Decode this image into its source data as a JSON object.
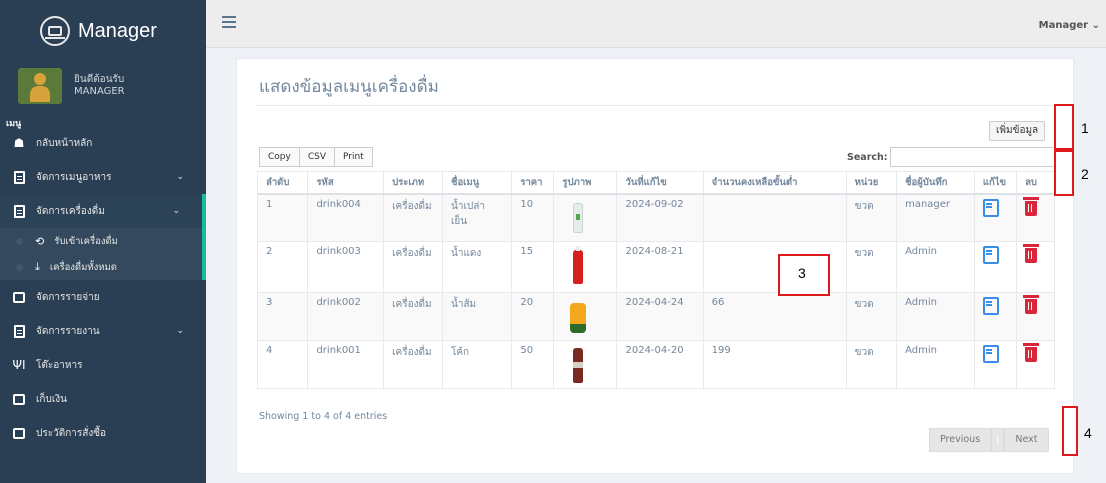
{
  "app": {
    "title": "Manager"
  },
  "profile": {
    "welcome": "ยินดีต้อนรับ",
    "name": "MANAGER"
  },
  "sidebar": {
    "heading": "เมนู",
    "items": [
      {
        "label": "กลับหน้าหลัก",
        "icon": "home-icon"
      },
      {
        "label": "จัดการเมนูอาหาร",
        "icon": "document-icon",
        "chevron": "⌄"
      },
      {
        "label": "จัดการเครื่องดื่ม",
        "icon": "document-icon",
        "chevron": "⌄"
      },
      {
        "label": "จัดการรายจ่าย",
        "icon": "money-icon"
      },
      {
        "label": "จัดการรายงาน",
        "icon": "document-icon",
        "chevron": "⌄"
      },
      {
        "label": "โต๊ะอาหาร",
        "icon": "utensils-icon"
      },
      {
        "label": "เก็บเงิน",
        "icon": "money-icon"
      },
      {
        "label": "ประวัติการสั่งซื้อ",
        "icon": "money-icon"
      }
    ],
    "submenu": [
      {
        "label": "รับเข้าเครื่องดื่ม",
        "icon": "intake-icon"
      },
      {
        "label": "เครื่องดื่มทั้งหมด",
        "icon": "download-icon"
      }
    ]
  },
  "topbar": {
    "user": "Manager",
    "caret": "⌄"
  },
  "main": {
    "title": "แสดงข้อมูลเมนูเครื่องดื่ม",
    "add_button": "เพิ่มข้อมูล",
    "export_buttons": [
      "Copy",
      "CSV",
      "Print"
    ],
    "search_label": "Search:",
    "search_value": "",
    "columns": [
      "ลำดับ",
      "รหัส",
      "ประเภท",
      "ชื่อเมนู",
      "ราคา",
      "รูปภาพ",
      "วันที่แก้ไข",
      "จำนวนคงเหลือขั้นต่ำ",
      "หน่วย",
      "ชื่อผู้บันทึก",
      "แก้ไข",
      "ลบ"
    ],
    "rows": [
      {
        "no": "1",
        "code": "drink004",
        "type": "เครื่องดื่ม",
        "name": "น้ำเปล่า เย็น",
        "price": "10",
        "image": "water-bottle",
        "date": "2024-09-02",
        "min_stock": "",
        "unit": "ขวด",
        "recorder": "manager"
      },
      {
        "no": "2",
        "code": "drink003",
        "type": "เครื่องดื่ม",
        "name": "น้ำแดง",
        "price": "15",
        "image": "red-soda-bottle",
        "date": "2024-08-21",
        "min_stock": "",
        "unit": "ขวด",
        "recorder": "Admin"
      },
      {
        "no": "3",
        "code": "drink002",
        "type": "เครื่องดื่ม",
        "name": "น้ำส้ม",
        "price": "20",
        "image": "orange-juice-bottle",
        "date": "2024-04-24",
        "min_stock": "66",
        "unit": "ขวด",
        "recorder": "Admin"
      },
      {
        "no": "4",
        "code": "drink001",
        "type": "เครื่องดื่ม",
        "name": "โค้ก",
        "price": "50",
        "image": "cola-bottle",
        "date": "2024-04-20",
        "min_stock": "199",
        "unit": "ขวด",
        "recorder": "Admin"
      }
    ],
    "info": "Showing 1 to 4 of 4 entries",
    "pager": {
      "previous": "Previous",
      "next": "Next"
    }
  },
  "annotations": [
    "1",
    "2",
    "3",
    "4"
  ],
  "colors": {
    "sidebar": "#2a3f54",
    "accent": "#1abb9c",
    "marker": "#e0191f",
    "edit": "#3a8ee6",
    "delete": "#d9263a"
  }
}
